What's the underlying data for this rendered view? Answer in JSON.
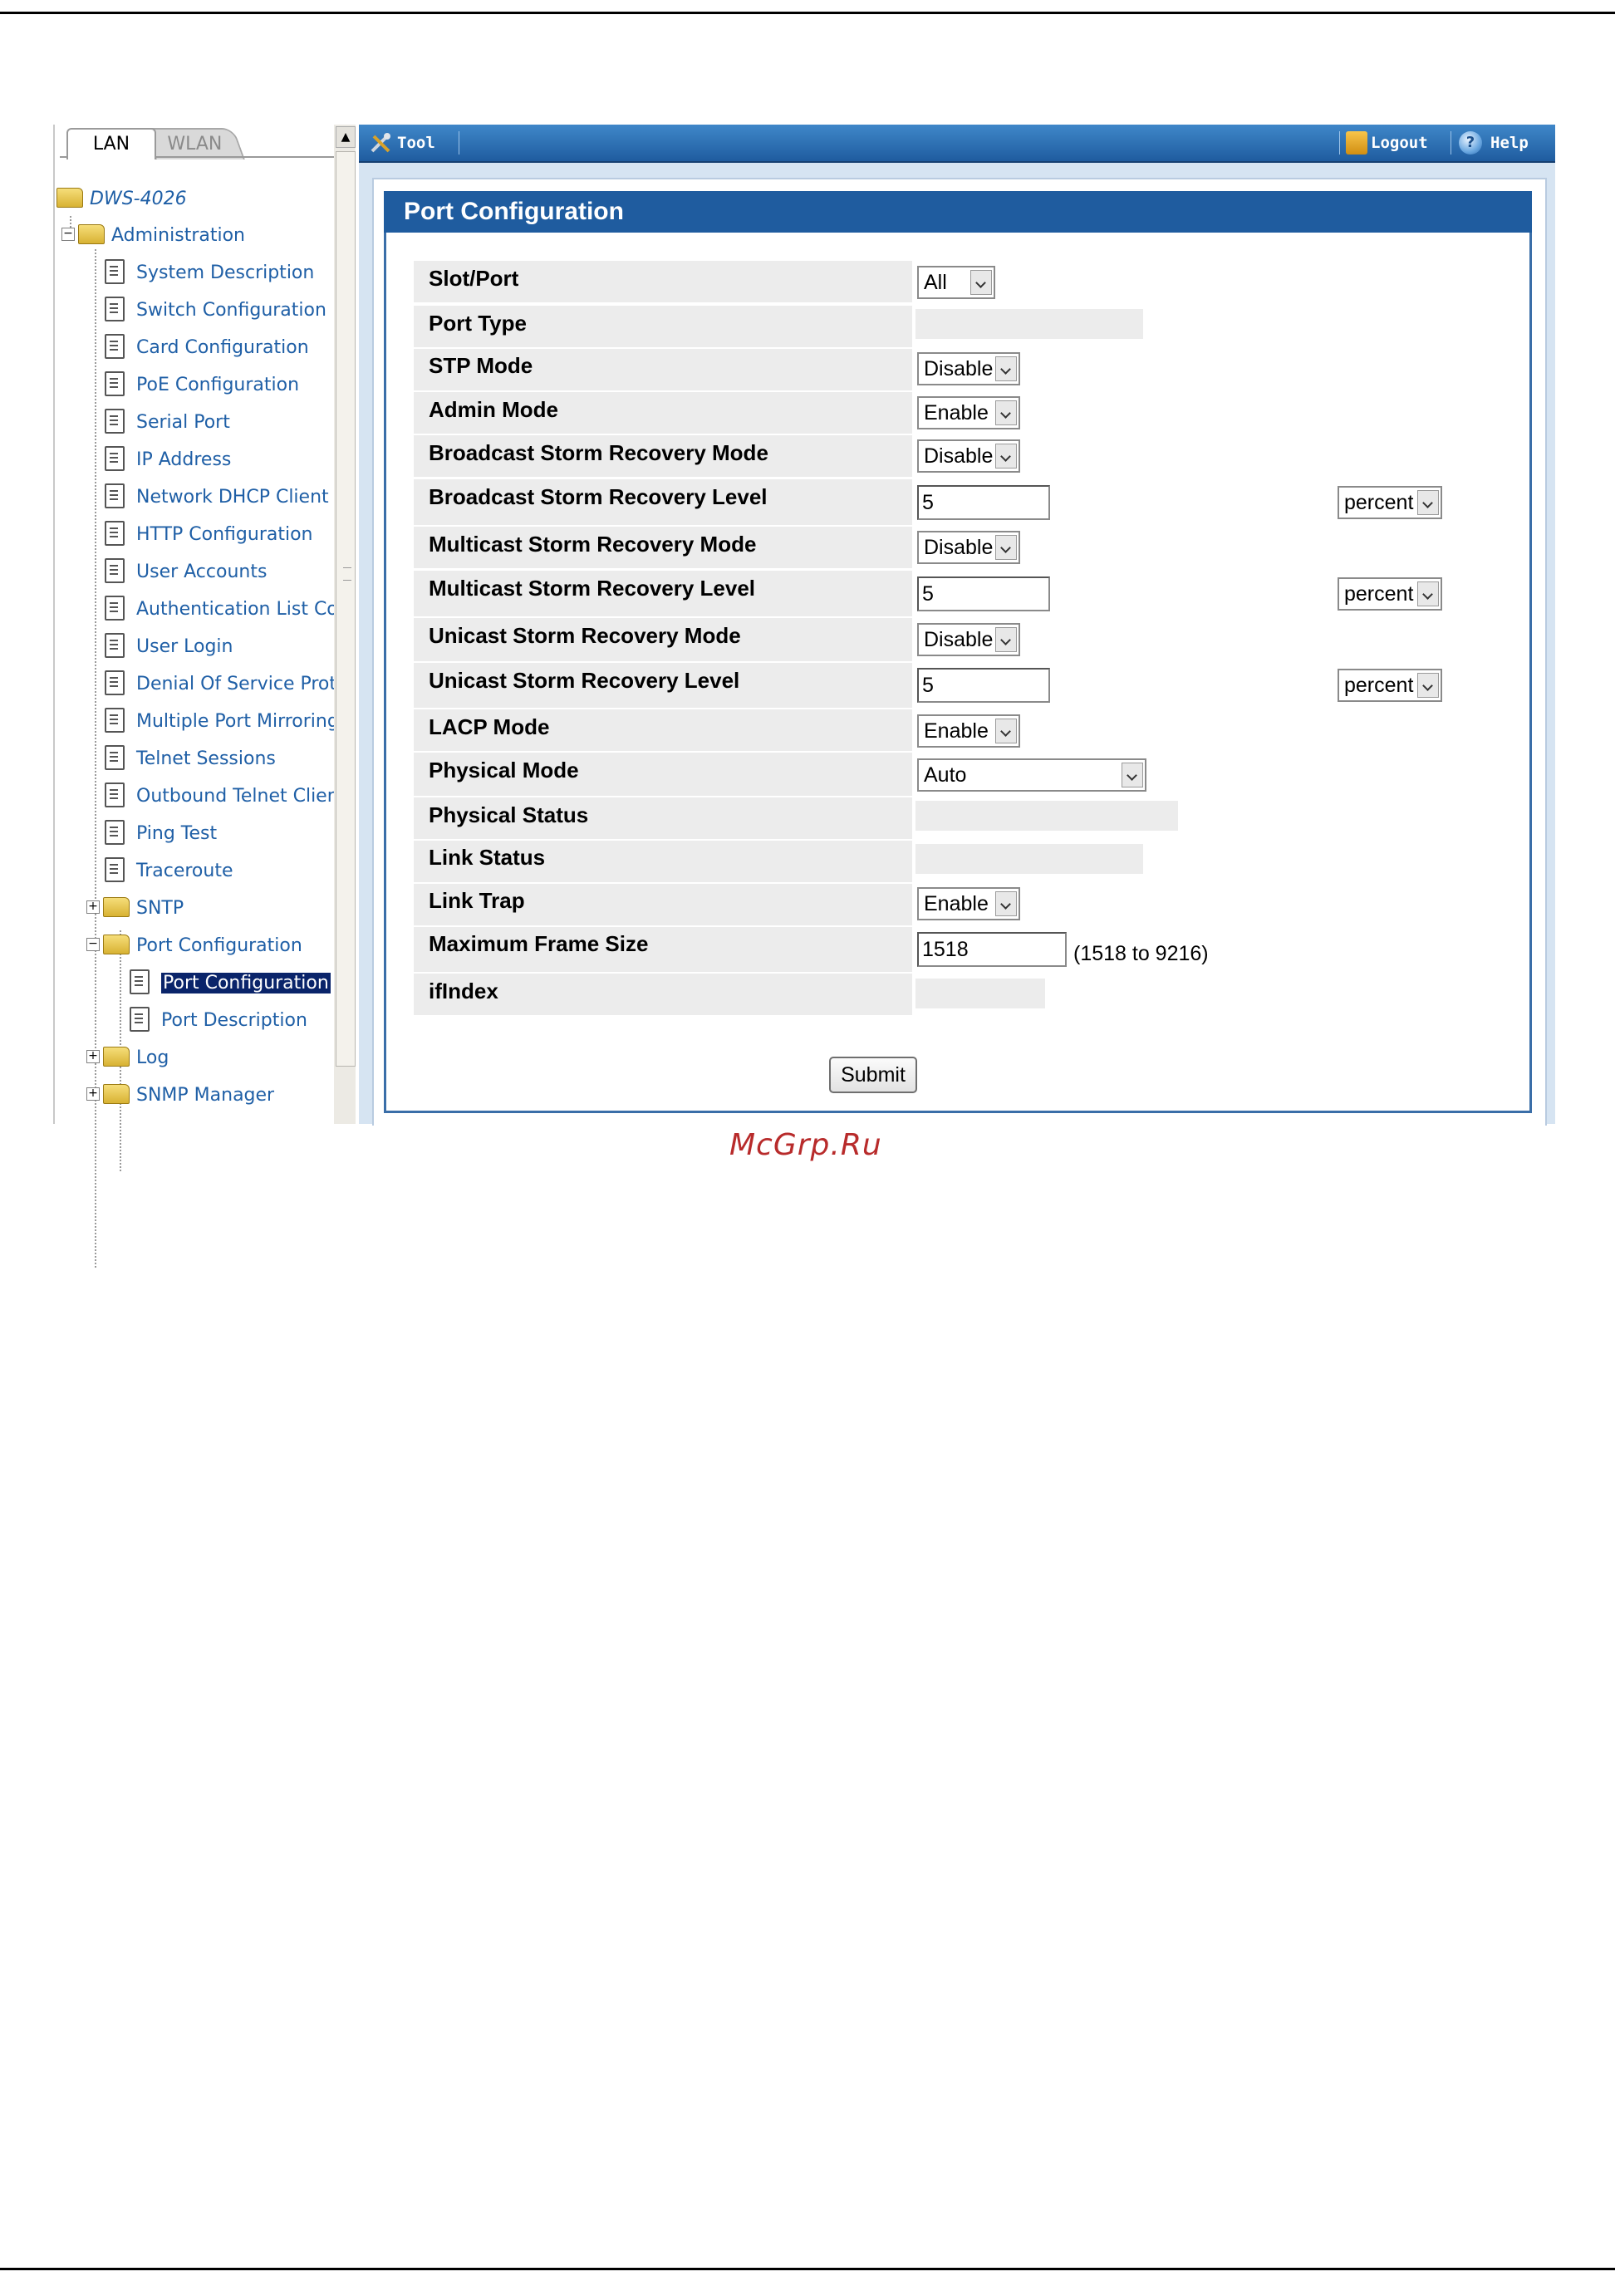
{
  "nav": {
    "tabs": {
      "lan": "LAN",
      "wlan": "WLAN"
    },
    "root": "DWS-4026",
    "admin": "Administration",
    "items": [
      "System Description",
      "Switch Configuration",
      "Card Configuration",
      "PoE Configuration",
      "Serial Port",
      "IP Address",
      "Network DHCP Client (",
      "HTTP Configuration",
      "User Accounts",
      "Authentication List Cor",
      "User Login",
      "Denial Of Service Prot",
      "Multiple Port Mirroring",
      "Telnet Sessions",
      "Outbound Telnet Clien",
      "Ping Test",
      "Traceroute"
    ],
    "sntp": "SNTP",
    "port_config_folder": "Port Configuration",
    "port_config_selected": "Port Configuration",
    "port_description": "Port Description",
    "log": "Log",
    "snmp": "SNMP Manager"
  },
  "toolbar": {
    "tool": "Tool",
    "logout": "Logout",
    "help": "Help"
  },
  "panel": {
    "title": "Port Configuration",
    "rows": {
      "slot_port": {
        "label": "Slot/Port",
        "value": "All"
      },
      "port_type": {
        "label": "Port Type"
      },
      "stp_mode": {
        "label": "STP Mode",
        "value": "Disable"
      },
      "admin_mode": {
        "label": "Admin Mode",
        "value": "Enable"
      },
      "bsr_mode": {
        "label": "Broadcast Storm Recovery Mode",
        "value": "Disable"
      },
      "bsr_level": {
        "label": "Broadcast Storm Recovery Level",
        "value": "5",
        "unit": "percent"
      },
      "msr_mode": {
        "label": "Multicast Storm Recovery Mode",
        "value": "Disable"
      },
      "msr_level": {
        "label": "Multicast Storm Recovery Level",
        "value": "5",
        "unit": "percent"
      },
      "usr_mode": {
        "label": "Unicast Storm Recovery Mode",
        "value": "Disable"
      },
      "usr_level": {
        "label": "Unicast Storm Recovery Level",
        "value": "5",
        "unit": "percent"
      },
      "lacp_mode": {
        "label": "LACP Mode",
        "value": "Enable"
      },
      "physical_mode": {
        "label": "Physical Mode",
        "value": "Auto"
      },
      "physical_status": {
        "label": "Physical Status"
      },
      "link_status": {
        "label": "Link Status"
      },
      "link_trap": {
        "label": "Link Trap",
        "value": "Enable"
      },
      "max_frame": {
        "label": "Maximum Frame Size",
        "value": "1518",
        "hint": "(1518 to 9216)"
      },
      "ifindex": {
        "label": "ifIndex"
      }
    },
    "submit": "Submit"
  },
  "watermark": "McGrp.Ru"
}
